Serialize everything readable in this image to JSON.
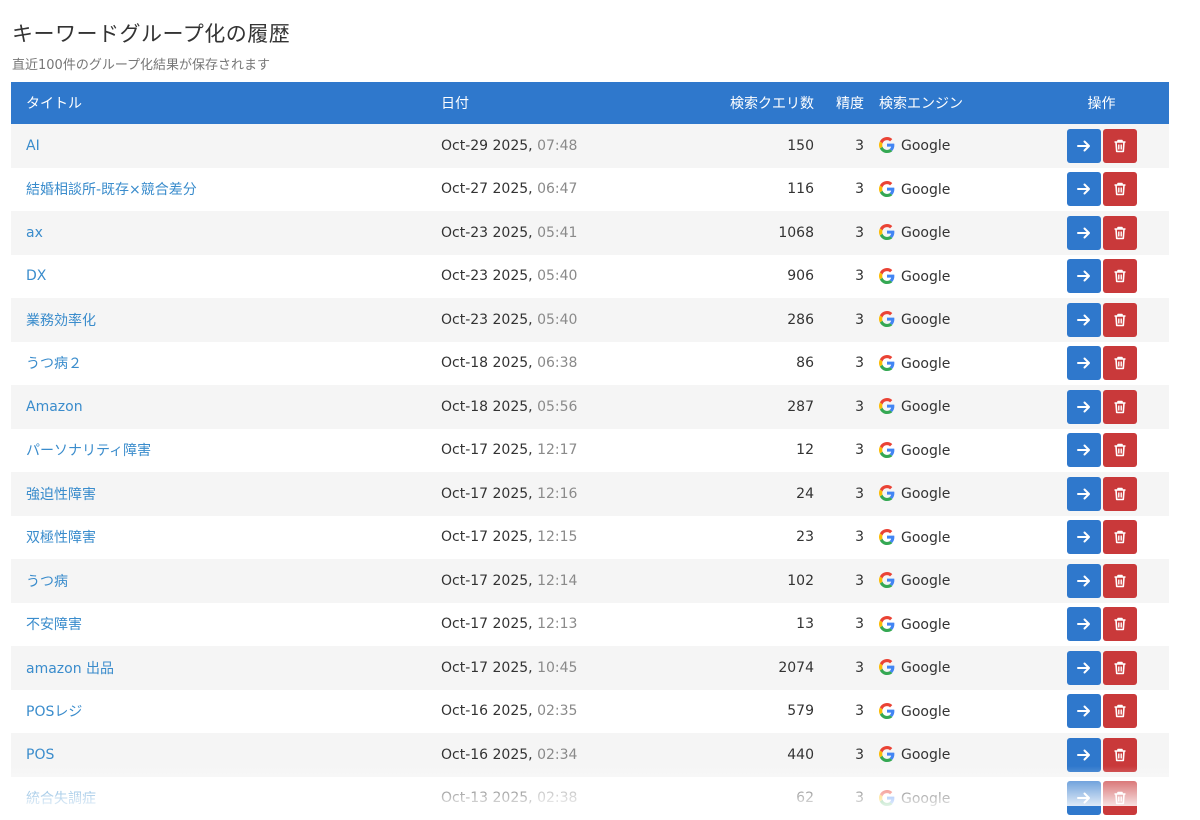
{
  "header": {
    "title": "キーワードグループ化の履歴",
    "subtitle": "直近100件のグループ化結果が保存されます"
  },
  "table": {
    "columns": {
      "title": "タイトル",
      "date": "日付",
      "query_count": "検索クエリ数",
      "precision": "精度",
      "engine": "検索エンジン",
      "actions": "操作"
    },
    "rows": [
      {
        "title": "AI",
        "date": "Oct-29 2025,",
        "time": "07:48",
        "count": "150",
        "precision": "3",
        "engine": "Google"
      },
      {
        "title": "結婚相談所-既存×競合差分",
        "date": "Oct-27 2025,",
        "time": "06:47",
        "count": "116",
        "precision": "3",
        "engine": "Google"
      },
      {
        "title": "ax",
        "date": "Oct-23 2025,",
        "time": "05:41",
        "count": "1068",
        "precision": "3",
        "engine": "Google"
      },
      {
        "title": "DX",
        "date": "Oct-23 2025,",
        "time": "05:40",
        "count": "906",
        "precision": "3",
        "engine": "Google"
      },
      {
        "title": "業務効率化",
        "date": "Oct-23 2025,",
        "time": "05:40",
        "count": "286",
        "precision": "3",
        "engine": "Google"
      },
      {
        "title": "うつ病２",
        "date": "Oct-18 2025,",
        "time": "06:38",
        "count": "86",
        "precision": "3",
        "engine": "Google"
      },
      {
        "title": "Amazon",
        "date": "Oct-18 2025,",
        "time": "05:56",
        "count": "287",
        "precision": "3",
        "engine": "Google"
      },
      {
        "title": "パーソナリティ障害",
        "date": "Oct-17 2025,",
        "time": "12:17",
        "count": "12",
        "precision": "3",
        "engine": "Google"
      },
      {
        "title": "強迫性障害",
        "date": "Oct-17 2025,",
        "time": "12:16",
        "count": "24",
        "precision": "3",
        "engine": "Google"
      },
      {
        "title": "双極性障害",
        "date": "Oct-17 2025,",
        "time": "12:15",
        "count": "23",
        "precision": "3",
        "engine": "Google"
      },
      {
        "title": "うつ病",
        "date": "Oct-17 2025,",
        "time": "12:14",
        "count": "102",
        "precision": "3",
        "engine": "Google"
      },
      {
        "title": "不安障害",
        "date": "Oct-17 2025,",
        "time": "12:13",
        "count": "13",
        "precision": "3",
        "engine": "Google"
      },
      {
        "title": "amazon 出品",
        "date": "Oct-17 2025,",
        "time": "10:45",
        "count": "2074",
        "precision": "3",
        "engine": "Google"
      },
      {
        "title": "POSレジ",
        "date": "Oct-16 2025,",
        "time": "02:35",
        "count": "579",
        "precision": "3",
        "engine": "Google"
      },
      {
        "title": "POS",
        "date": "Oct-16 2025,",
        "time": "02:34",
        "count": "440",
        "precision": "3",
        "engine": "Google"
      },
      {
        "title": "統合失調症",
        "date": "Oct-13 2025,",
        "time": "02:38",
        "count": "62",
        "precision": "3",
        "engine": "Google"
      }
    ]
  },
  "icons": {
    "open": "arrow-right-icon",
    "delete": "trash-icon",
    "engine": "google-icon"
  },
  "colors": {
    "header_bg": "#2f78cc",
    "link": "#3a8ccc",
    "open_button": "#2f78cc",
    "delete_button": "#c9393a",
    "row_stripe": "#f5f5f5"
  }
}
